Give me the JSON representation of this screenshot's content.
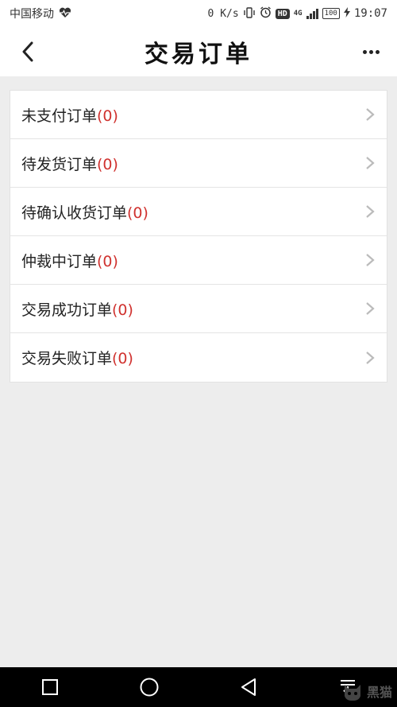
{
  "status_bar": {
    "carrier": "中国移动",
    "net_speed": "0 K/s",
    "hd_badge": "HD",
    "network_type": "4G",
    "battery": "100",
    "time": "19:07"
  },
  "header": {
    "title": "交易订单",
    "back_icon": "chevron-left-icon",
    "more_icon": "more-horizontal-icon"
  },
  "menu": {
    "items": [
      {
        "label": "未支付订单",
        "count": "(0)"
      },
      {
        "label": "待发货订单",
        "count": "(0)"
      },
      {
        "label": "待确认收货订单",
        "count": "(0)"
      },
      {
        "label": "仲裁中订单",
        "count": "(0)"
      },
      {
        "label": "交易成功订单",
        "count": "(0)"
      },
      {
        "label": "交易失败订单",
        "count": "(0)"
      }
    ]
  },
  "nav_bar": {
    "icons": [
      "square-recents-icon",
      "circle-home-icon",
      "triangle-back-icon",
      "pull-down-icon"
    ]
  },
  "watermark": {
    "text": "黑猫"
  },
  "colors": {
    "count_red": "#d0322f",
    "background": "#ededed",
    "card": "#ffffff"
  }
}
